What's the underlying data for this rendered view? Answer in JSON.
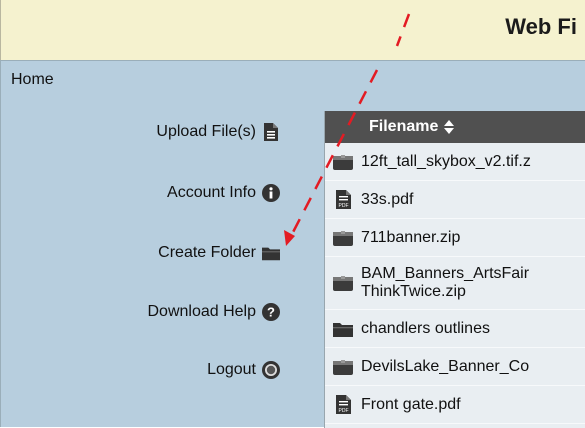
{
  "header": {
    "title": "Web Fi"
  },
  "sidebar": {
    "home": "Home",
    "items": [
      {
        "label": "Upload File(s)",
        "icon": "document-icon"
      },
      {
        "label": "Account Info",
        "icon": "info-icon"
      },
      {
        "label": "Create Folder",
        "icon": "folder-icon"
      },
      {
        "label": "Download Help",
        "icon": "help-icon"
      },
      {
        "label": "Logout",
        "icon": "logout-icon"
      }
    ]
  },
  "files": {
    "header": "Filename",
    "rows": [
      {
        "name": "12ft_tall_skybox_v2.tif.z",
        "type": "archive"
      },
      {
        "name": "33s.pdf",
        "type": "pdf"
      },
      {
        "name": "711banner.zip",
        "type": "archive"
      },
      {
        "name": "BAM_Banners_ArtsFair",
        "name2": "ThinkTwice.zip",
        "type": "archive"
      },
      {
        "name": "chandlers outlines",
        "type": "folder"
      },
      {
        "name": "DevilsLake_Banner_Co",
        "type": "archive"
      },
      {
        "name": "Front gate.pdf",
        "type": "pdf"
      }
    ]
  },
  "colors": {
    "title_bg": "#f5f2cf",
    "panel_bg": "#b7cede",
    "table_header": "#505050",
    "annotation": "#e31b23"
  }
}
